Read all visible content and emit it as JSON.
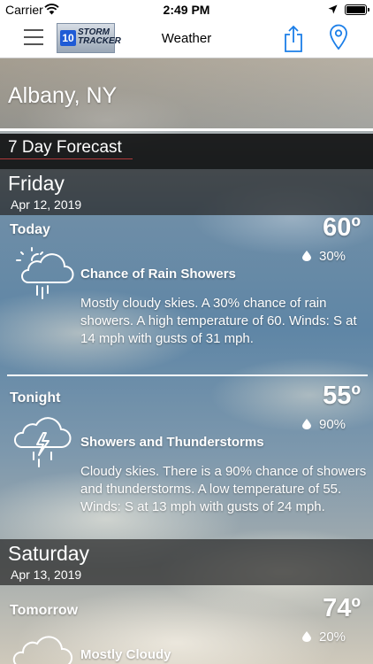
{
  "status_bar": {
    "carrier": "Carrier",
    "time": "2:49 PM"
  },
  "nav": {
    "logo_badge": "10",
    "logo_text": "STORM TRACKER",
    "title": "Weather"
  },
  "location": "Albany, NY",
  "section_title": "7 Day Forecast",
  "days": [
    {
      "name": "Friday",
      "date": "Apr 12, 2019",
      "periods": [
        {
          "name": "Today",
          "temp": "60º",
          "precip": "30%",
          "icon": "rain-showers-icon",
          "condition": "Chance of Rain Showers",
          "description": "Mostly cloudy skies.  A 30% chance of rain showers.  A high temperature of 60.  Winds: S at 14 mph with gusts of 31 mph."
        },
        {
          "name": "Tonight",
          "temp": "55º",
          "precip": "90%",
          "icon": "thunderstorm-icon",
          "condition": "Showers and Thunderstorms",
          "description": "Cloudy skies. There is a 90% chance of showers and thunderstorms.  A low temperature of 55.  Winds: S at 13 mph with gusts of 24 mph."
        }
      ]
    },
    {
      "name": "Saturday",
      "date": "Apr 13, 2019",
      "periods": [
        {
          "name": "Tomorrow",
          "temp": "74º",
          "precip": "20%",
          "icon": "partly-cloudy-icon",
          "condition": "Mostly Cloudy",
          "description": ""
        }
      ]
    }
  ]
}
